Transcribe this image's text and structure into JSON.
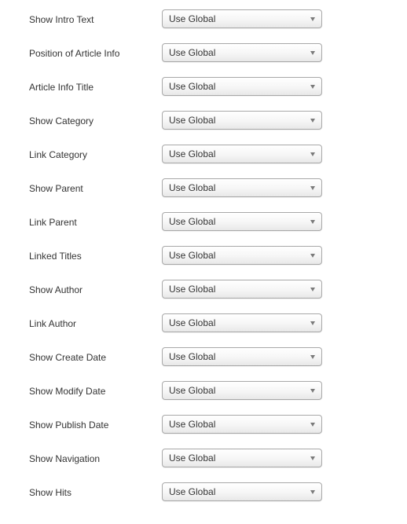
{
  "settings": [
    {
      "label": "Show Intro Text",
      "value": "Use Global"
    },
    {
      "label": "Position of Article Info",
      "value": "Use Global"
    },
    {
      "label": "Article Info Title",
      "value": "Use Global"
    },
    {
      "label": "Show Category",
      "value": "Use Global"
    },
    {
      "label": "Link Category",
      "value": "Use Global"
    },
    {
      "label": "Show Parent",
      "value": "Use Global"
    },
    {
      "label": "Link Parent",
      "value": "Use Global"
    },
    {
      "label": "Linked Titles",
      "value": "Use Global"
    },
    {
      "label": "Show Author",
      "value": "Use Global"
    },
    {
      "label": "Link Author",
      "value": "Use Global"
    },
    {
      "label": "Show Create Date",
      "value": "Use Global"
    },
    {
      "label": "Show Modify Date",
      "value": "Use Global"
    },
    {
      "label": "Show Publish Date",
      "value": "Use Global"
    },
    {
      "label": "Show Navigation",
      "value": "Use Global"
    },
    {
      "label": "Show Hits",
      "value": "Use Global"
    }
  ],
  "icons": {
    "dropdown": "chevron-down-icon"
  },
  "colors": {
    "label_text": "#333333",
    "select_border": "#a8a8a8",
    "arrow": "#7a7a7a"
  }
}
